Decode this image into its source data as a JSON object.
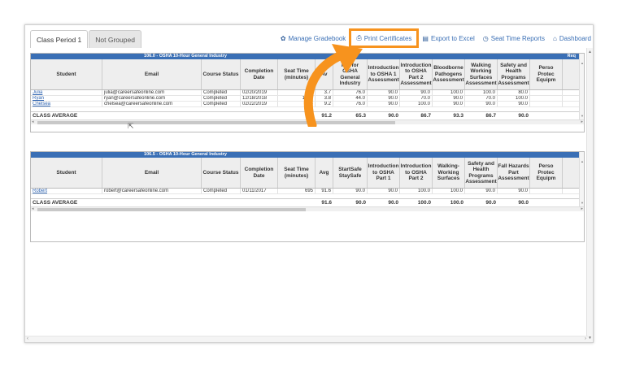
{
  "tabs": [
    {
      "label": "Class Period 1",
      "active": true
    },
    {
      "label": "Not Grouped",
      "active": false
    }
  ],
  "toolbar": {
    "manage": "Manage Gradebook",
    "print": "Print Certificates",
    "export": "Export to Excel",
    "seat": "Seat Time Reports",
    "dashboard": "Dashboard"
  },
  "icons": {
    "manage": "gear-icon",
    "print": "printer-icon",
    "export": "excel-icon",
    "seat": "clock-icon",
    "dashboard": "home-icon"
  },
  "colors": {
    "header_band": "#3a6fb5",
    "highlight": "#f7931e",
    "link": "#2f64b1"
  },
  "grid1": {
    "course": "106.0 - OSHA 10-Hour General Industry",
    "req": "Req",
    "headers": [
      "Student",
      "Email",
      "Course Status",
      "Completion Date",
      "Seat Time (minutes)",
      "Avg",
      "Prepare for OSHA General Industry",
      "Introduction to OSHA 1 Assessment",
      "Introduction to OSHA Part 2 Assessment",
      "Bloodborne Pathogens Assessment",
      "Walking Working Surfaces Assessment",
      "Safety and Health Programs Assessment",
      "Personal Protective Equipment"
    ],
    "header_display": [
      "Student",
      "Email",
      "Course Status",
      "Completion Date",
      "Seat Time (minutes)",
      "Av",
      "Pr   t for OSHA General Industry",
      "Introduction to OSHA 1 Assessment",
      "Introduction to OSHA Part 2 Assessment",
      "Bloodborne Pathogens Assessment",
      "Walking Working Surfaces Assessment",
      "Safety and Health Programs Assessment",
      "Perso Protec Equipm"
    ],
    "rows": [
      [
        "Julia",
        "julia@careersafeonline.com",
        "Completed",
        "02/20/2019",
        "740",
        "3.7",
        "76.0",
        "90.0",
        "90.0",
        "100.0",
        "100.0",
        "80.0",
        ""
      ],
      [
        "Ryan",
        "ryan@careersafeonline.com",
        "Completed",
        "12/18/2018",
        "1793",
        "3.8",
        "44.0",
        "90.0",
        "70.0",
        "90.0",
        "70.0",
        "100.0",
        ""
      ],
      [
        "Chelsea",
        "chelsea@careersafeonline.com",
        "Completed",
        "02/22/2019",
        "644",
        "9.2",
        "76.0",
        "90.0",
        "100.0",
        "90.0",
        "90.0",
        "90.0",
        ""
      ]
    ],
    "average_label": "CLASS AVERAGE",
    "average": [
      "",
      "",
      "",
      "",
      "",
      "91.2",
      "65.3",
      "90.0",
      "86.7",
      "93.3",
      "86.7",
      "90.0",
      ""
    ]
  },
  "grid2": {
    "course": "106.5 - OSHA 10-Hour General Industry",
    "headers": [
      "Student",
      "Email",
      "Course Status",
      "Completion Date",
      "Seat Time (minutes)",
      "Avg",
      "StartSafe StaySafe",
      "Introduction to OSHA Part 1",
      "Introduction to OSHA Part 2",
      "Walking-Working Surfaces",
      "Safety and Health Programs Assessment",
      "Fall Hazards Part Assessment",
      "Personal Protective Equipment"
    ],
    "header_display": [
      "Student",
      "Email",
      "Course Status",
      "Completion Date",
      "Seat Time (minutes)",
      "Avg",
      "StartSafe StaySafe",
      "Introduction to OSHA Part 1",
      "Introduction to OSHA Part 2",
      "Walking-Working Surfaces",
      "Safety and Health Programs Assessment",
      "Fall Hazards Part Assessment",
      "Perso Protec Equipm"
    ],
    "rows": [
      [
        "Robert",
        "robert@careersafeonline.com",
        "Completed",
        "01/11/2017",
        "695",
        "91.6",
        "90.0",
        "90.0",
        "100.0",
        "100.0",
        "90.0",
        "90.0",
        ""
      ]
    ],
    "average_label": "CLASS AVERAGE",
    "average": [
      "",
      "",
      "",
      "",
      "",
      "91.6",
      "90.0",
      "90.0",
      "100.0",
      "100.0",
      "90.0",
      "90.0",
      ""
    ]
  }
}
